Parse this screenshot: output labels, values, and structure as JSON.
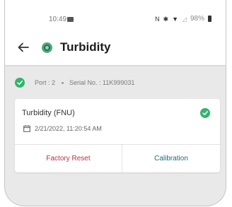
{
  "status_bar": {
    "time": "10:49",
    "battery": "98%",
    "icons": [
      "image-icon",
      "nfc-icon",
      "vibrate-icon",
      "wifi-icon",
      "signal-icon",
      "battery-icon"
    ]
  },
  "header": {
    "title": "Turbidity",
    "back_icon": "arrow-left-icon",
    "sensor_icon": "sensor-icon"
  },
  "port_info": {
    "port": "Port : 2",
    "serial": "Serial No. : 11K999031",
    "status_color": "#2fb66a"
  },
  "card": {
    "title": "Turbidity (FNU)",
    "timestamp": "2/21/2022, 11:20:54 AM",
    "factory_reset_label": "Factory Reset",
    "calibration_label": "Calibration",
    "reset_color": "#b5304a",
    "calibration_color": "#1e6a86"
  }
}
